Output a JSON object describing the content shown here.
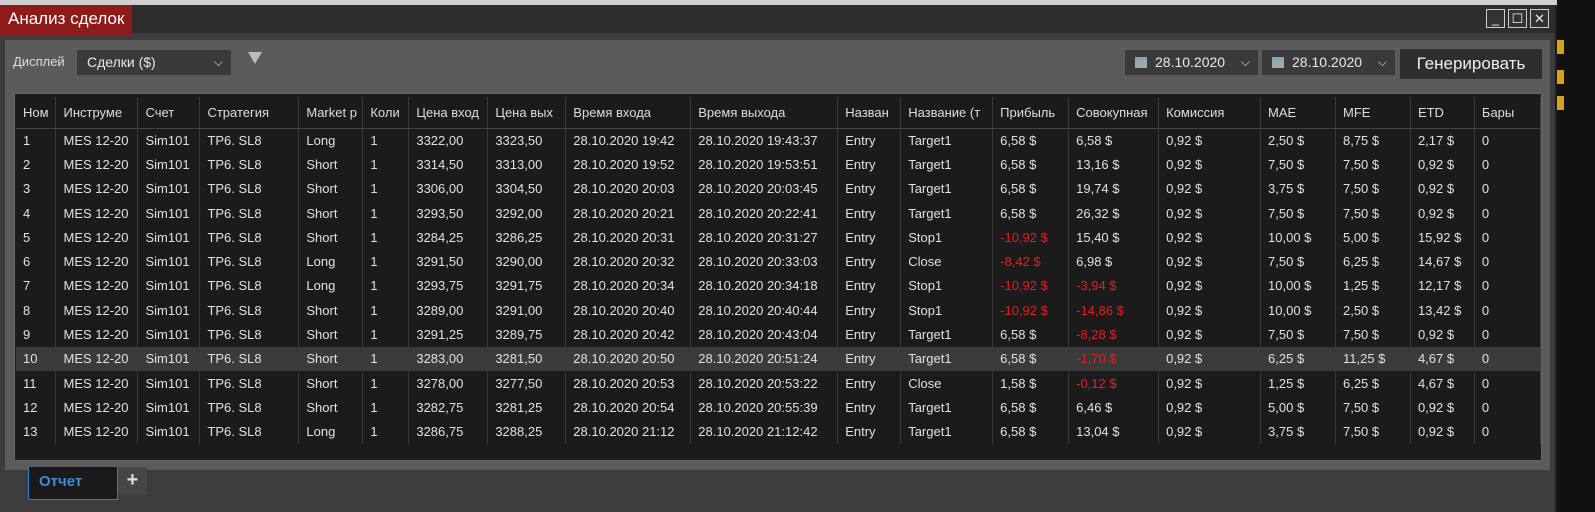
{
  "window": {
    "title": "Анализ сделок",
    "minimize": "_",
    "maximize": "☐",
    "close": "✕"
  },
  "toolbar": {
    "display_label": "Дисплей",
    "display_value": "Сделки ($)",
    "filter_icon": "filter-icon",
    "date_from": "28.10.2020",
    "date_to": "28.10.2020",
    "generate": "Генерировать"
  },
  "table": {
    "columns": [
      "Ном",
      "Инструме",
      "Счет",
      "Стратегия",
      "Market p",
      "Коли",
      "Цена вход",
      "Цена вых",
      "Время входа",
      "Время выхода",
      "Назван",
      "Название (т",
      "Прибыль",
      "Совокупная",
      "Комиссия",
      "MAE",
      "MFE",
      "ETD",
      "Бары"
    ],
    "rows": [
      [
        "1",
        "MES 12-20",
        "Sim101",
        "TP6. SL8",
        "Long",
        "1",
        "3322,00",
        "3323,50",
        "28.10.2020 19:42",
        "28.10.2020 19:43:37",
        "Entry",
        "Target1",
        "6,58 $",
        "6,58 $",
        "0,92 $",
        "2,50 $",
        "8,75 $",
        "2,17 $",
        "0"
      ],
      [
        "2",
        "MES 12-20",
        "Sim101",
        "TP6. SL8",
        "Short",
        "1",
        "3314,50",
        "3313,00",
        "28.10.2020 19:52",
        "28.10.2020 19:53:51",
        "Entry",
        "Target1",
        "6,58 $",
        "13,16 $",
        "0,92 $",
        "7,50 $",
        "7,50 $",
        "0,92 $",
        "0"
      ],
      [
        "3",
        "MES 12-20",
        "Sim101",
        "TP6. SL8",
        "Short",
        "1",
        "3306,00",
        "3304,50",
        "28.10.2020 20:03",
        "28.10.2020 20:03:45",
        "Entry",
        "Target1",
        "6,58 $",
        "19,74 $",
        "0,92 $",
        "3,75 $",
        "7,50 $",
        "0,92 $",
        "0"
      ],
      [
        "4",
        "MES 12-20",
        "Sim101",
        "TP6. SL8",
        "Short",
        "1",
        "3293,50",
        "3292,00",
        "28.10.2020 20:21",
        "28.10.2020 20:22:41",
        "Entry",
        "Target1",
        "6,58 $",
        "26,32 $",
        "0,92 $",
        "7,50 $",
        "7,50 $",
        "0,92 $",
        "0"
      ],
      [
        "5",
        "MES 12-20",
        "Sim101",
        "TP6. SL8",
        "Short",
        "1",
        "3284,25",
        "3286,25",
        "28.10.2020 20:31",
        "28.10.2020 20:31:27",
        "Entry",
        "Stop1",
        "-10,92 $",
        "15,40 $",
        "0,92 $",
        "10,00 $",
        "5,00 $",
        "15,92 $",
        "0"
      ],
      [
        "6",
        "MES 12-20",
        "Sim101",
        "TP6. SL8",
        "Long",
        "1",
        "3291,50",
        "3290,00",
        "28.10.2020 20:32",
        "28.10.2020 20:33:03",
        "Entry",
        "Close",
        "-8,42 $",
        "6,98 $",
        "0,92 $",
        "7,50 $",
        "6,25 $",
        "14,67 $",
        "0"
      ],
      [
        "7",
        "MES 12-20",
        "Sim101",
        "TP6. SL8",
        "Long",
        "1",
        "3293,75",
        "3291,75",
        "28.10.2020 20:34",
        "28.10.2020 20:34:18",
        "Entry",
        "Stop1",
        "-10,92 $",
        "-3,94 $",
        "0,92 $",
        "10,00 $",
        "1,25 $",
        "12,17 $",
        "0"
      ],
      [
        "8",
        "MES 12-20",
        "Sim101",
        "TP6. SL8",
        "Short",
        "1",
        "3289,00",
        "3291,00",
        "28.10.2020 20:40",
        "28.10.2020 20:40:44",
        "Entry",
        "Stop1",
        "-10,92 $",
        "-14,86 $",
        "0,92 $",
        "10,00 $",
        "2,50 $",
        "13,42 $",
        "0"
      ],
      [
        "9",
        "MES 12-20",
        "Sim101",
        "TP6. SL8",
        "Short",
        "1",
        "3291,25",
        "3289,75",
        "28.10.2020 20:42",
        "28.10.2020 20:43:04",
        "Entry",
        "Target1",
        "6,58 $",
        "-8,28 $",
        "0,92 $",
        "7,50 $",
        "7,50 $",
        "0,92 $",
        "0"
      ],
      [
        "10",
        "MES 12-20",
        "Sim101",
        "TP6. SL8",
        "Short",
        "1",
        "3283,00",
        "3281,50",
        "28.10.2020 20:50",
        "28.10.2020 20:51:24",
        "Entry",
        "Target1",
        "6,58 $",
        "-1,70 $",
        "0,92 $",
        "6,25 $",
        "11,25 $",
        "4,67 $",
        "0"
      ],
      [
        "11",
        "MES 12-20",
        "Sim101",
        "TP6. SL8",
        "Short",
        "1",
        "3278,00",
        "3277,50",
        "28.10.2020 20:53",
        "28.10.2020 20:53:22",
        "Entry",
        "Close",
        "1,58 $",
        "-0,12 $",
        "0,92 $",
        "1,25 $",
        "6,25 $",
        "4,67 $",
        "0"
      ],
      [
        "12",
        "MES 12-20",
        "Sim101",
        "TP6. SL8",
        "Short",
        "1",
        "3282,75",
        "3281,25",
        "28.10.2020 20:54",
        "28.10.2020 20:55:39",
        "Entry",
        "Target1",
        "6,58 $",
        "6,46 $",
        "0,92 $",
        "5,00 $",
        "7,50 $",
        "0,92 $",
        "0"
      ],
      [
        "13",
        "MES 12-20",
        "Sim101",
        "TP6. SL8",
        "Long",
        "1",
        "3286,75",
        "3288,25",
        "28.10.2020 21:12",
        "28.10.2020 21:12:42",
        "Entry",
        "Target1",
        "6,58 $",
        "13,04 $",
        "0,92 $",
        "3,75 $",
        "7,50 $",
        "0,92 $",
        "0"
      ]
    ],
    "selected_row": "10"
  },
  "tabs": {
    "items": [
      "Отчет"
    ],
    "add": "+"
  },
  "colors": {
    "title_bg": "#8e1b1b",
    "negative": "#e02020",
    "tab_active": "#3b8ee0"
  }
}
